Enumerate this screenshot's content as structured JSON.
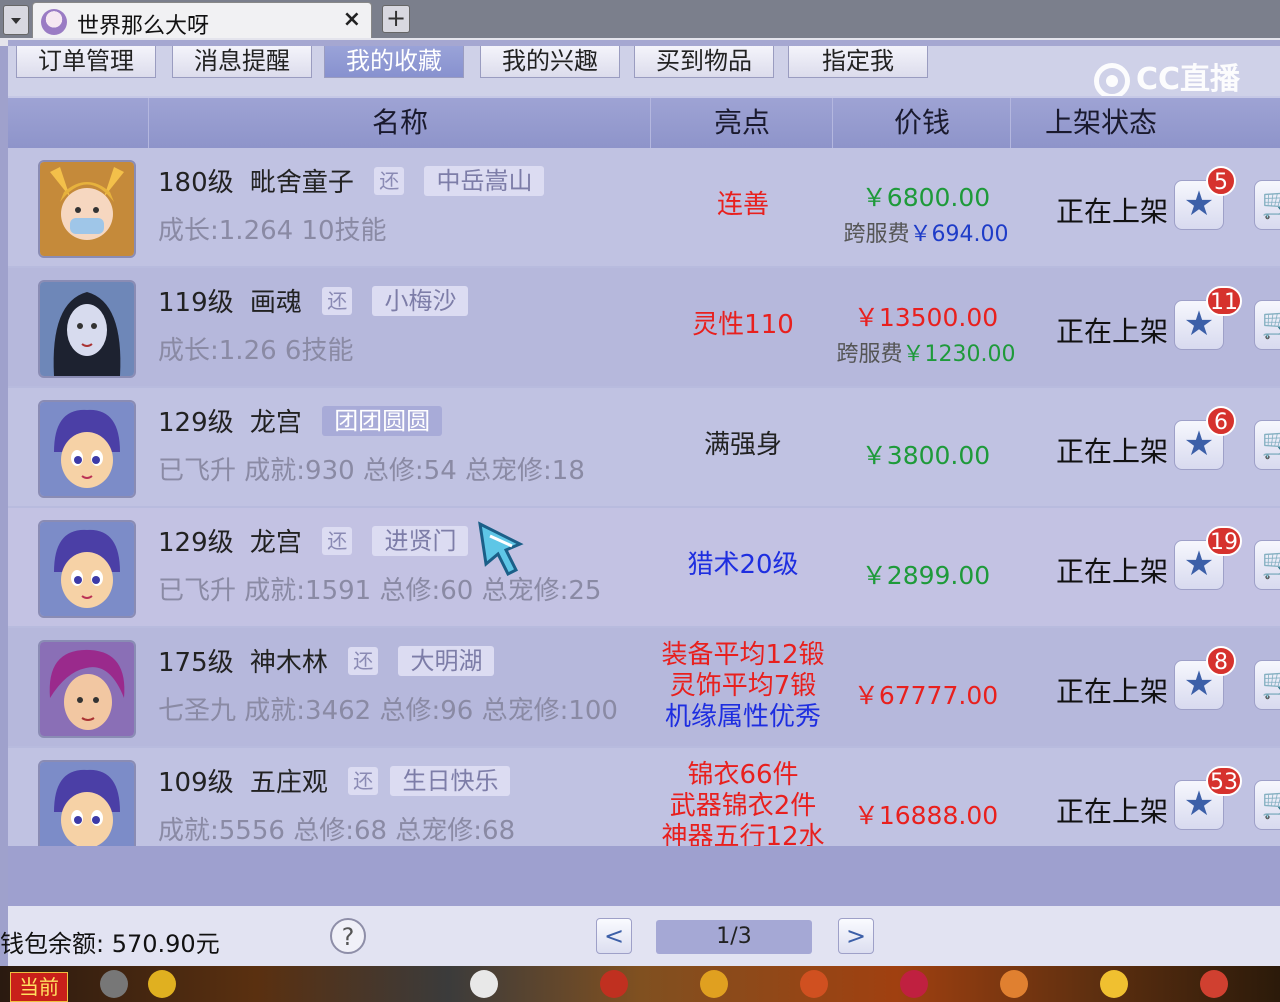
{
  "browser": {
    "tab_title": "世界那么大呀",
    "tab_close": "×",
    "new_tab": "+"
  },
  "watermark": "CC直播",
  "menu": [
    {
      "label": "订单管理",
      "active": false
    },
    {
      "label": "消息提醒",
      "active": false
    },
    {
      "label": "我的收藏",
      "active": true
    },
    {
      "label": "我的兴趣",
      "active": false
    },
    {
      "label": "买到物品",
      "active": false
    },
    {
      "label": "指定我",
      "active": false
    }
  ],
  "columns": {
    "name": "名称",
    "highlight": "亮点",
    "price": "价钱",
    "status": "上架状态"
  },
  "rows": [
    {
      "level": "180级",
      "name": "毗舍童子",
      "returnable": "还",
      "server": "中岳嵩山",
      "detail": "成长:1.264  10技能",
      "highlight": [
        "连善"
      ],
      "highlight_colors": [
        "#e8201e"
      ],
      "price": "￥6800.00",
      "price_color": "#1e9a3a",
      "fee_label": "跨服费",
      "fee": "￥694.00",
      "fee_color": "#1e3cc8",
      "status": "正在上架",
      "favorites": "5"
    },
    {
      "level": "119级",
      "name": "画魂",
      "returnable": "还",
      "server": "小梅沙",
      "detail": "成长:1.26  6技能",
      "highlight": [
        "灵性110"
      ],
      "highlight_colors": [
        "#e8201e"
      ],
      "price": "￥13500.00",
      "price_color": "#e8201e",
      "fee_label": "跨服费",
      "fee": "￥1230.00",
      "fee_color": "#1e9a3a",
      "status": "正在上架",
      "favorites": "11"
    },
    {
      "level": "129级",
      "name": "龙宫",
      "returnable": "",
      "server": "团团圆圆",
      "detail": "已飞升  成就:930  总修:54  总宠修:18",
      "highlight": [
        "满强身"
      ],
      "highlight_colors": [
        "#222222"
      ],
      "price": "￥3800.00",
      "price_color": "#1e9a3a",
      "fee_label": "",
      "fee": "",
      "fee_color": "",
      "status": "正在上架",
      "favorites": "6"
    },
    {
      "level": "129级",
      "name": "龙宫",
      "returnable": "还",
      "server": "进贤门",
      "detail": "已飞升  成就:1591  总修:60  总宠修:25",
      "highlight": [
        "猎术20级"
      ],
      "highlight_colors": [
        "#1e2ee0"
      ],
      "price": "￥2899.00",
      "price_color": "#1e9a3a",
      "fee_label": "",
      "fee": "",
      "fee_color": "",
      "status": "正在上架",
      "favorites": "19"
    },
    {
      "level": "175级",
      "name": "神木林",
      "returnable": "还",
      "server": "大明湖",
      "detail": "七圣九  成就:3462  总修:96  总宠修:100",
      "highlight": [
        "装备平均12锻",
        "灵饰平均7锻",
        "机缘属性优秀"
      ],
      "highlight_colors": [
        "#e8201e",
        "#e8201e",
        "#1e2ee0"
      ],
      "price": "￥67777.00",
      "price_color": "#e8201e",
      "fee_label": "",
      "fee": "",
      "fee_color": "",
      "status": "正在上架",
      "favorites": "8"
    },
    {
      "level": "109级",
      "name": "五庄观",
      "returnable": "还",
      "server": "生日快乐",
      "detail": "成就:5556  总修:68  总宠修:68",
      "highlight": [
        "锦衣66件",
        "武器锦衣2件",
        "神器五行12水"
      ],
      "highlight_colors": [
        "#e8201e",
        "#e8201e",
        "#e8201e"
      ],
      "price": "￥16888.00",
      "price_color": "#e8201e",
      "fee_label": "",
      "fee": "",
      "fee_color": "",
      "status": "正在上架",
      "favorites": "53"
    }
  ],
  "footer": {
    "wallet": "钱包余额: 570.90元",
    "help": "?",
    "prev": "<",
    "next": ">",
    "page": "1/3"
  },
  "gamebar": {
    "current": "当前"
  },
  "icons": {
    "favorite": "star-icon",
    "cart": "cart-icon",
    "help": "question-icon"
  }
}
